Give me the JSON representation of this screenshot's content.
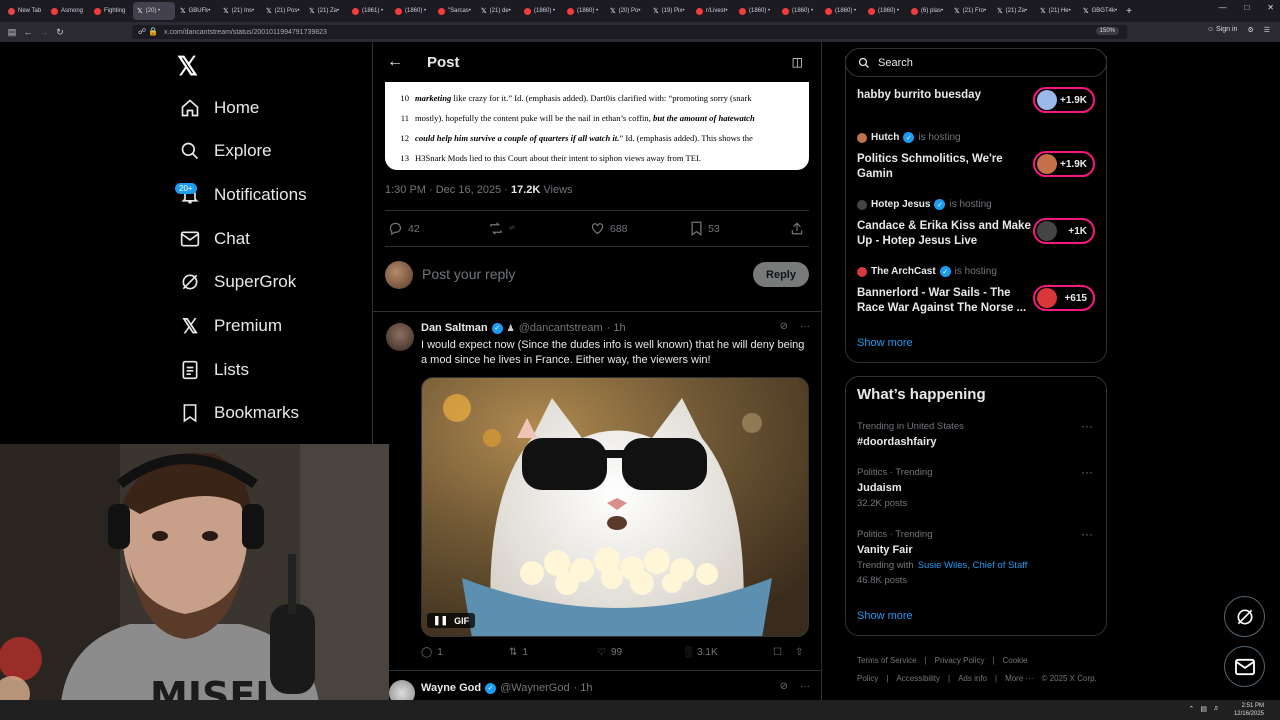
{
  "browser": {
    "tabs": [
      {
        "label": "New Tab",
        "fav": "n"
      },
      {
        "label": "Asmong",
        "fav": "r"
      },
      {
        "label": "Fighting",
        "fav": "r"
      },
      {
        "label": "(20) •",
        "fav": "x",
        "active": true
      },
      {
        "label": "GBUFk•",
        "fav": "x"
      },
      {
        "label": "(21) Ins•",
        "fav": "x"
      },
      {
        "label": "(21) Pos•",
        "fav": "x"
      },
      {
        "label": "(21) Za•",
        "fav": "x"
      },
      {
        "label": "(1861) •",
        "fav": "r"
      },
      {
        "label": "(1860) •",
        "fav": "r"
      },
      {
        "label": "\"Sarcas•",
        "fav": "r"
      },
      {
        "label": "(21) de•",
        "fav": "x"
      },
      {
        "label": "(1860) •",
        "fav": "r"
      },
      {
        "label": "(1860) •",
        "fav": "r"
      },
      {
        "label": "(20) Po•",
        "fav": "x"
      },
      {
        "label": "(19) Pix•",
        "fav": "x"
      },
      {
        "label": "r/Livest•",
        "fav": "r"
      },
      {
        "label": "(1860) •",
        "fav": "r"
      },
      {
        "label": "(1860) •",
        "fav": "r"
      },
      {
        "label": "(1860) •",
        "fav": "r"
      },
      {
        "label": "(1860) •",
        "fav": "r"
      },
      {
        "label": "(6) plas•",
        "fav": "r"
      },
      {
        "label": "(21) Fro•",
        "fav": "x"
      },
      {
        "label": "(21) Za•",
        "fav": "x"
      },
      {
        "label": "(21) He•",
        "fav": "x"
      },
      {
        "label": "GBGT4k•",
        "fav": "x"
      }
    ],
    "url": "x.com/dancantstream/status/2001011994791739823",
    "zoom": "150%",
    "signin": "Sign in"
  },
  "nav": {
    "items": [
      {
        "label": "Home",
        "icon": "home-icon"
      },
      {
        "label": "Explore",
        "icon": "search-icon"
      },
      {
        "label": "Notifications",
        "icon": "bell-icon",
        "badge": "20+"
      },
      {
        "label": "Chat",
        "icon": "mail-icon"
      },
      {
        "label": "SuperGrok",
        "icon": "grok-icon"
      },
      {
        "label": "Premium",
        "icon": "x-icon"
      },
      {
        "label": "Lists",
        "icon": "list-icon"
      },
      {
        "label": "Bookmarks",
        "icon": "bookmark-icon"
      }
    ]
  },
  "post": {
    "header": "Post",
    "doc_lines": [
      {
        "n": "10",
        "pre": "",
        "bi": "marketing",
        "post": " like crazy for it.” Id. (emphasis added). Dart0is clarified with: “promoting sorry (snark"
      },
      {
        "n": "11",
        "pre": "mostly). hopefully the content puke will be the nail in ethan’s coffin, ",
        "bi": "but the amount of hatewatch",
        "post": ""
      },
      {
        "n": "12",
        "pre": "",
        "bi": "could help him survive a couple of quarters if all watch it.",
        "post": "” Id. (emphasis added). This shows the"
      },
      {
        "n": "13",
        "pre": "H3Snark Mods lied to this Court about their intent to siphon views away from TEI.",
        "bi": "",
        "post": ""
      }
    ],
    "time": "1:30 PM · Dec 16, 2025 ·",
    "views_count": "17.2K",
    "views_label": "Views",
    "actions": {
      "replies": "42",
      "reposts": "⁴⁰",
      "likes": "688",
      "bookmarks": "53"
    },
    "reply_placeholder": "Post your reply",
    "reply_button": "Reply"
  },
  "replies": [
    {
      "name": "Dan Saltman",
      "handle": "@dancantstream",
      "time": "· 1h",
      "text": "I would expect now (Since the dudes info is well known) that he will deny being a mod since he lives in France. Either way, the viewers win!",
      "gif_label": "GIF",
      "actions": {
        "replies": "1",
        "reposts": "1",
        "likes": "99",
        "views": "3.1K"
      }
    },
    {
      "name": "Wayne God",
      "handle": "@WaynerGod",
      "time": "· 1h"
    }
  ],
  "right": {
    "search_placeholder": "Search",
    "spaces": [
      {
        "host": "",
        "hosting": "",
        "title": "habby burrito buesday",
        "count": "+1.9K",
        "color": "#9ab8e8"
      },
      {
        "host": "Hutch",
        "hosting": "is hosting",
        "title": "Politics Schmolitics, We're Gamin",
        "count": "+1.9K",
        "color": "#c4704a"
      },
      {
        "host": "Hotep Jesus",
        "hosting": "is hosting",
        "title": "Candace & Erika Kiss and Make Up - Hotep Jesus Live",
        "count": "+1K",
        "color": "#444444"
      },
      {
        "host": "The ArchCast",
        "hosting": "is hosting",
        "title": "Bannerlord - War Sails - The Race War Against The Norse ...",
        "count": "+615",
        "color": "#d8383a"
      }
    ],
    "spaces_show_more": "Show more",
    "whats_happening": "What’s happening",
    "trends": [
      {
        "meta": "Trending in United States",
        "name": "#doordashfairy",
        "posts": "",
        "with": ""
      },
      {
        "meta": "Politics · Trending",
        "name": "Judaism",
        "posts": "32.2K posts",
        "with": ""
      },
      {
        "meta": "Politics · Trending",
        "name": "Vanity Fair",
        "posts": "46.8K posts",
        "with": "Trending with",
        "with_links": "Susie Wiles, Chief of Staff"
      }
    ],
    "trends_show_more": "Show more",
    "footer": [
      "Terms of Service",
      "|",
      "Privacy Policy",
      "|",
      "Cookie Policy",
      "|",
      "Accessibility",
      "|",
      "Ads info",
      "|",
      "More ···",
      "© 2025 X Corp."
    ]
  },
  "taskbar": {
    "time": "2:51 PM",
    "date": "12/16/2025"
  },
  "colors": {
    "accent": "#1d9bf0",
    "live": "#f91880",
    "border": "#2f3336",
    "muted": "#71767b"
  }
}
